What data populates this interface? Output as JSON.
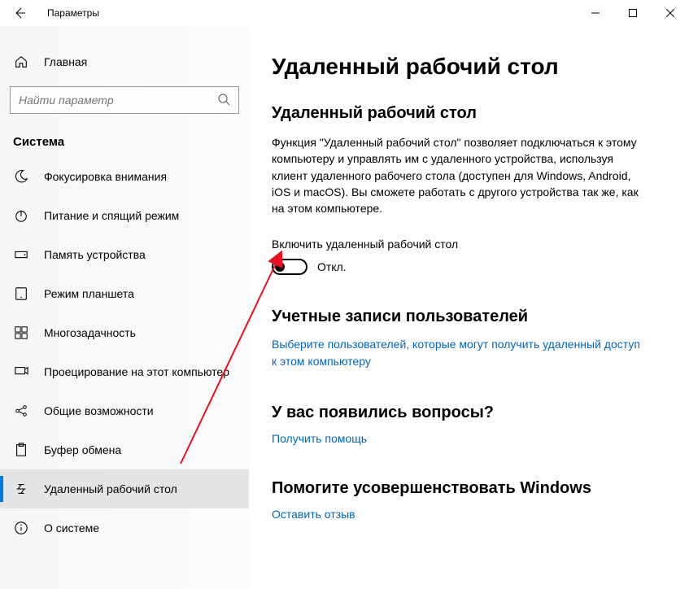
{
  "titlebar": {
    "title": "Параметры"
  },
  "sidebar": {
    "home": "Главная",
    "search_placeholder": "Найти параметр",
    "section": "Система",
    "items": [
      {
        "id": "focus-assist",
        "label": "Фокусировка внимания"
      },
      {
        "id": "power-sleep",
        "label": "Питание и спящий режим"
      },
      {
        "id": "storage",
        "label": "Память устройства"
      },
      {
        "id": "tablet-mode",
        "label": "Режим планшета"
      },
      {
        "id": "multitasking",
        "label": "Многозадачность"
      },
      {
        "id": "projecting",
        "label": "Проецирование на этот компьютер"
      },
      {
        "id": "shared-experiences",
        "label": "Общие возможности"
      },
      {
        "id": "clipboard",
        "label": "Буфер обмена"
      },
      {
        "id": "remote-desktop",
        "label": "Удаленный рабочий стол"
      },
      {
        "id": "about",
        "label": "О системе"
      }
    ]
  },
  "content": {
    "page_title": "Удаленный рабочий стол",
    "sub_title": "Удаленный рабочий стол",
    "description": "Функция \"Удаленный рабочий стол\" позволяет подключаться к этому компьютеру и управлять им с удаленного устройства, используя клиент удаленного рабочего стола (доступен для Windows, Android, iOS и macOS). Вы сможете работать с другого устройства так же, как на этом компьютере.",
    "toggle_label": "Включить удаленный рабочий стол",
    "toggle_state": "Откл.",
    "accounts_title": "Учетные записи пользователей",
    "accounts_link": "Выберите пользователей, которые могут получить удаленный доступ к этом компьютеру",
    "help_title": "У вас появились вопросы?",
    "help_link": "Получить помощь",
    "feedback_title": "Помогите усовершенствовать Windows",
    "feedback_link": "Оставить отзыв"
  }
}
